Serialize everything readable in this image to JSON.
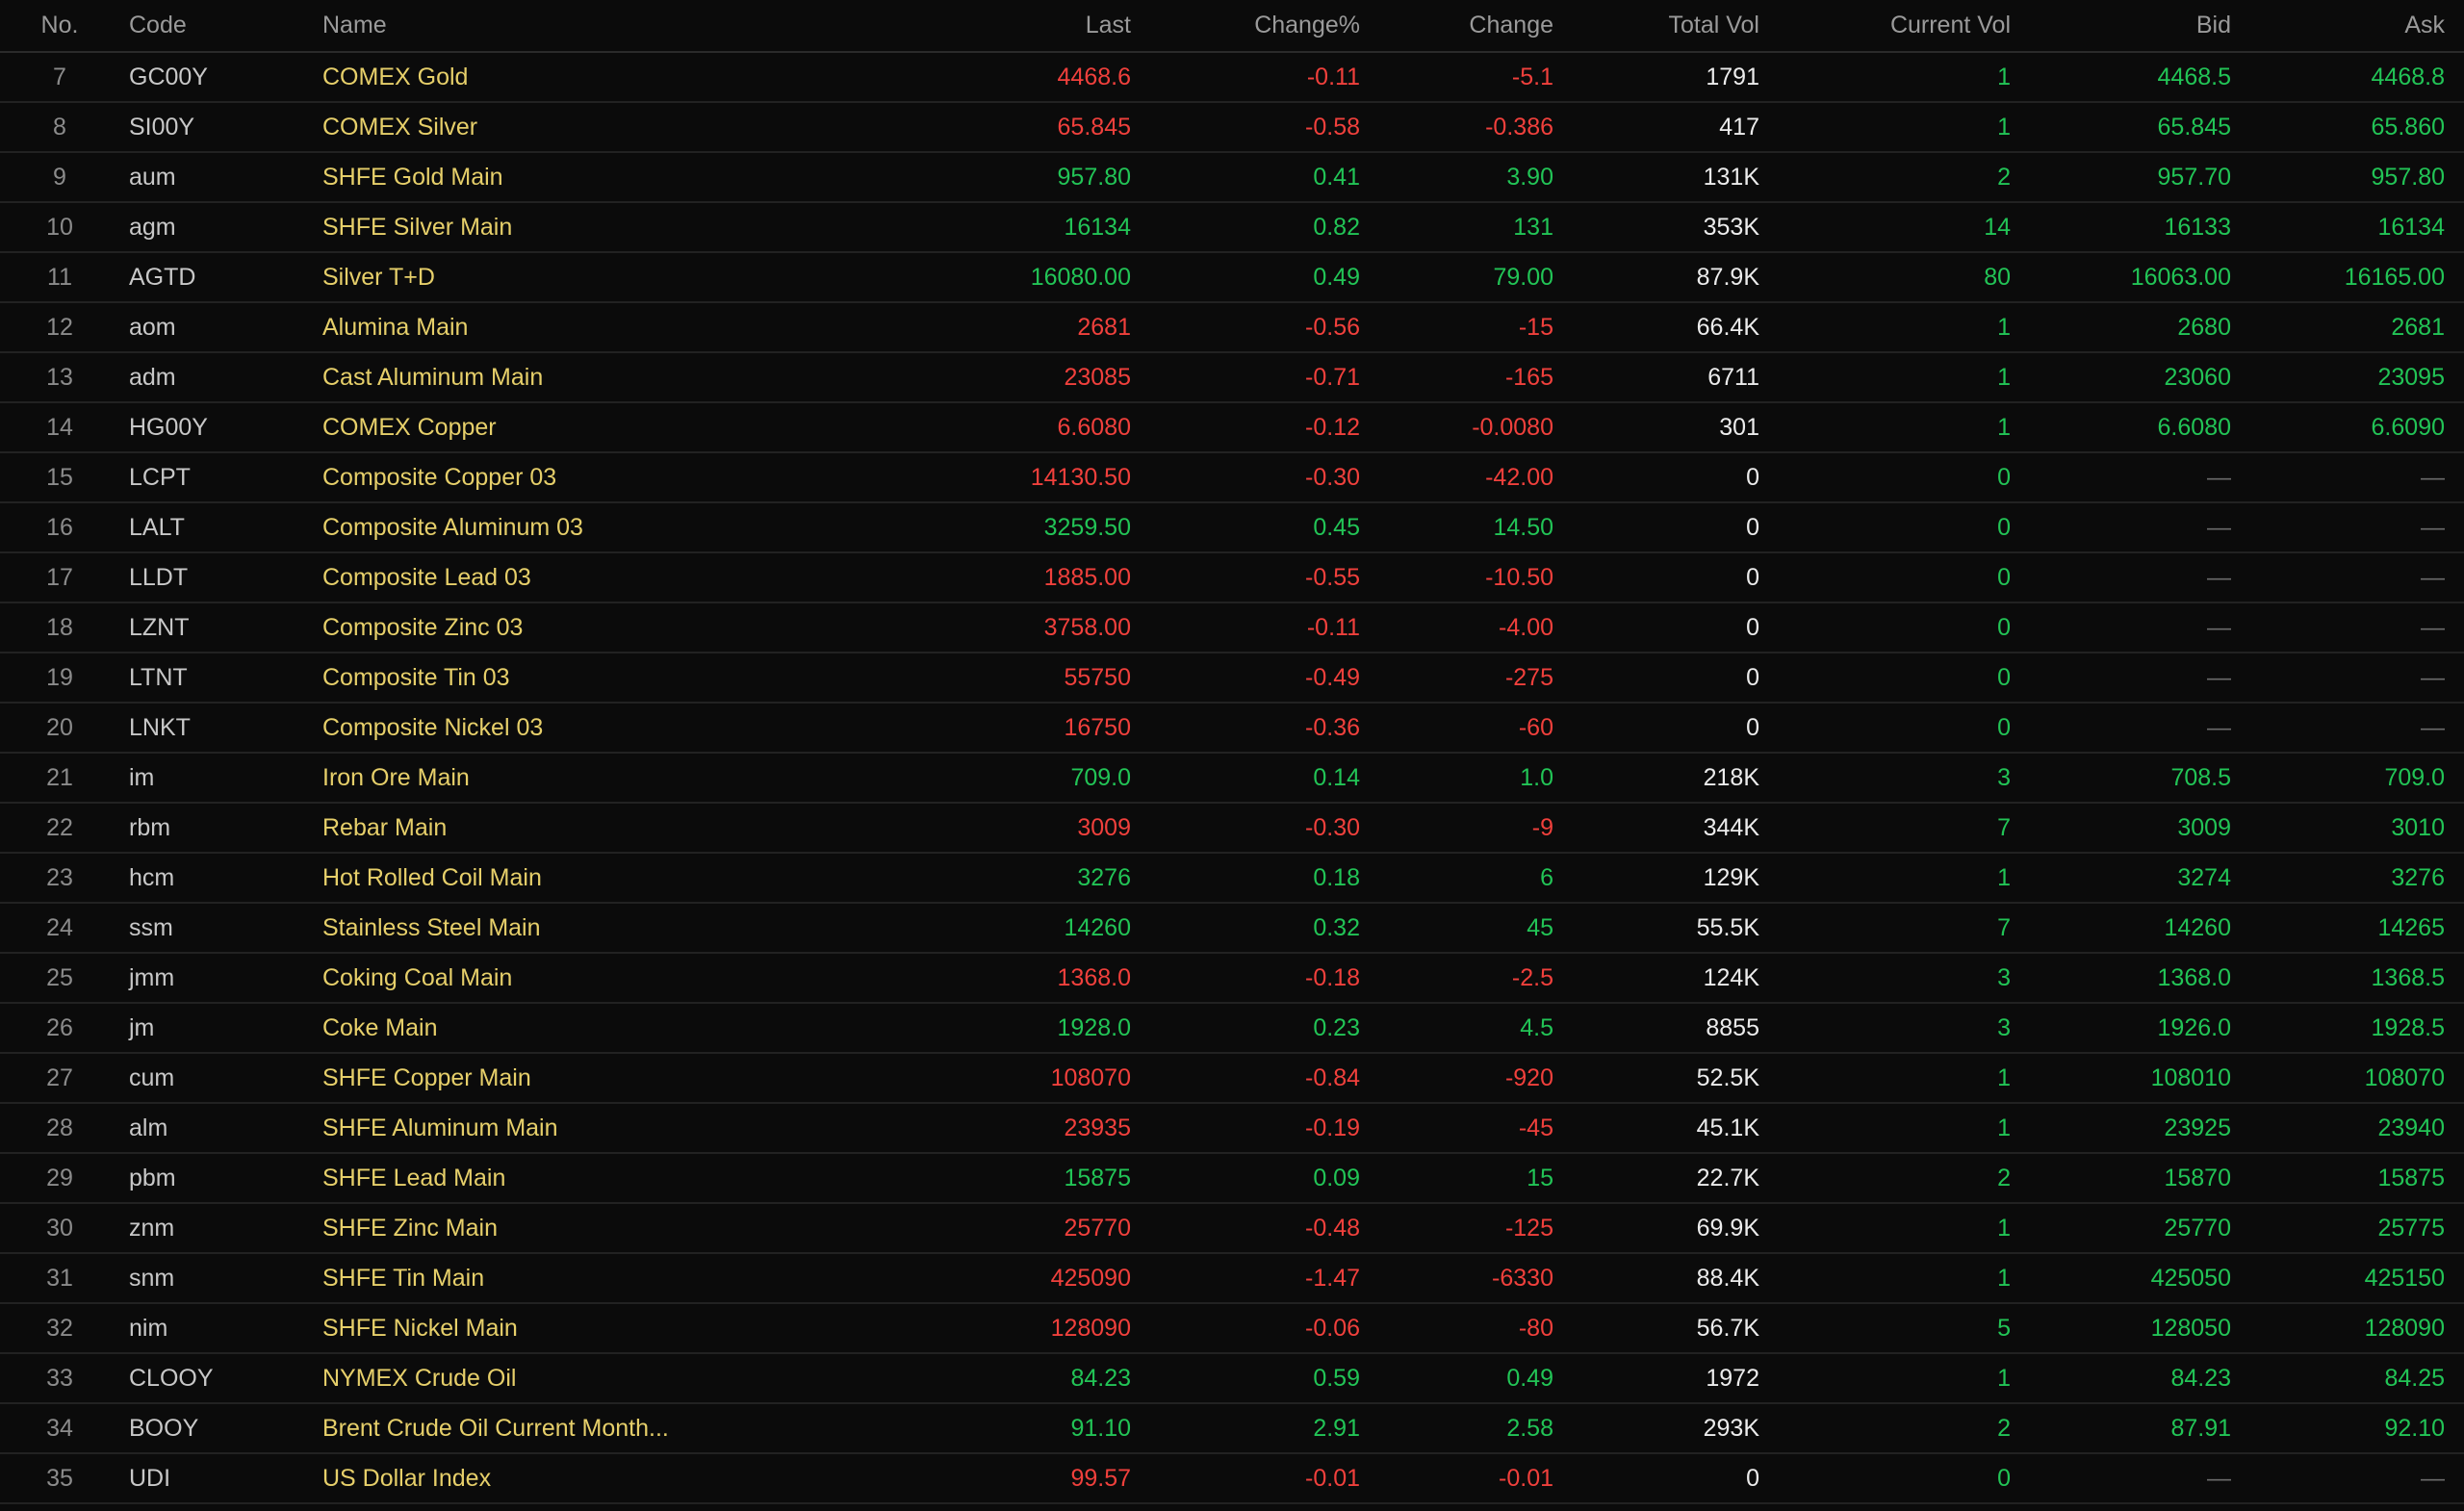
{
  "table": {
    "headers": {
      "no": "No.",
      "code": "Code",
      "name": "Name",
      "last": "Last",
      "change_pct": "Change%",
      "change": "Change",
      "total_vol": "Total Vol",
      "current_vol": "Current Vol",
      "bid": "Bid",
      "ask": "Ask"
    },
    "colors": {
      "up": "#22c456",
      "down": "#f0403c",
      "name": "#e6cf6a",
      "background": "#0b0b0b"
    },
    "rows": [
      {
        "no": "7",
        "code": "GC00Y",
        "name": "COMEX Gold",
        "last": "4468.6",
        "change_pct": "-0.11",
        "change": "-5.1",
        "total_vol": "1791",
        "current_vol": "1",
        "bid": "4468.5",
        "ask": "4468.8",
        "dir": "down"
      },
      {
        "no": "8",
        "code": "SI00Y",
        "name": "COMEX Silver",
        "last": "65.845",
        "change_pct": "-0.58",
        "change": "-0.386",
        "total_vol": "417",
        "current_vol": "1",
        "bid": "65.845",
        "ask": "65.860",
        "dir": "down"
      },
      {
        "no": "9",
        "code": "aum",
        "name": "SHFE Gold Main",
        "last": "957.80",
        "change_pct": "0.41",
        "change": "3.90",
        "total_vol": "131K",
        "current_vol": "2",
        "bid": "957.70",
        "ask": "957.80",
        "dir": "up"
      },
      {
        "no": "10",
        "code": "agm",
        "name": "SHFE Silver Main",
        "last": "16134",
        "change_pct": "0.82",
        "change": "131",
        "total_vol": "353K",
        "current_vol": "14",
        "bid": "16133",
        "ask": "16134",
        "dir": "up"
      },
      {
        "no": "11",
        "code": "AGTD",
        "name": "Silver T+D",
        "last": "16080.00",
        "change_pct": "0.49",
        "change": "79.00",
        "total_vol": "87.9K",
        "current_vol": "80",
        "bid": "16063.00",
        "ask": "16165.00",
        "dir": "up"
      },
      {
        "no": "12",
        "code": "aom",
        "name": "Alumina Main",
        "last": "2681",
        "change_pct": "-0.56",
        "change": "-15",
        "total_vol": "66.4K",
        "current_vol": "1",
        "bid": "2680",
        "ask": "2681",
        "dir": "down"
      },
      {
        "no": "13",
        "code": "adm",
        "name": "Cast Aluminum Main",
        "last": "23085",
        "change_pct": "-0.71",
        "change": "-165",
        "total_vol": "6711",
        "current_vol": "1",
        "bid": "23060",
        "ask": "23095",
        "dir": "down"
      },
      {
        "no": "14",
        "code": "HG00Y",
        "name": "COMEX Copper",
        "last": "6.6080",
        "change_pct": "-0.12",
        "change": "-0.0080",
        "total_vol": "301",
        "current_vol": "1",
        "bid": "6.6080",
        "ask": "6.6090",
        "dir": "down"
      },
      {
        "no": "15",
        "code": "LCPT",
        "name": "Composite Copper 03",
        "last": "14130.50",
        "change_pct": "-0.30",
        "change": "-42.00",
        "total_vol": "0",
        "current_vol": "0",
        "bid": "—",
        "ask": "—",
        "dir": "down"
      },
      {
        "no": "16",
        "code": "LALT",
        "name": "Composite Aluminum 03",
        "last": "3259.50",
        "change_pct": "0.45",
        "change": "14.50",
        "total_vol": "0",
        "current_vol": "0",
        "bid": "—",
        "ask": "—",
        "dir": "up"
      },
      {
        "no": "17",
        "code": "LLDT",
        "name": "Composite Lead 03",
        "last": "1885.00",
        "change_pct": "-0.55",
        "change": "-10.50",
        "total_vol": "0",
        "current_vol": "0",
        "bid": "—",
        "ask": "—",
        "dir": "down"
      },
      {
        "no": "18",
        "code": "LZNT",
        "name": "Composite Zinc 03",
        "last": "3758.00",
        "change_pct": "-0.11",
        "change": "-4.00",
        "total_vol": "0",
        "current_vol": "0",
        "bid": "—",
        "ask": "—",
        "dir": "down"
      },
      {
        "no": "19",
        "code": "LTNT",
        "name": "Composite Tin 03",
        "last": "55750",
        "change_pct": "-0.49",
        "change": "-275",
        "total_vol": "0",
        "current_vol": "0",
        "bid": "—",
        "ask": "—",
        "dir": "down"
      },
      {
        "no": "20",
        "code": "LNKT",
        "name": "Composite Nickel 03",
        "last": "16750",
        "change_pct": "-0.36",
        "change": "-60",
        "total_vol": "0",
        "current_vol": "0",
        "bid": "—",
        "ask": "—",
        "dir": "down"
      },
      {
        "no": "21",
        "code": "im",
        "name": "Iron Ore Main",
        "last": "709.0",
        "change_pct": "0.14",
        "change": "1.0",
        "total_vol": "218K",
        "current_vol": "3",
        "bid": "708.5",
        "ask": "709.0",
        "dir": "up"
      },
      {
        "no": "22",
        "code": "rbm",
        "name": "Rebar Main",
        "last": "3009",
        "change_pct": "-0.30",
        "change": "-9",
        "total_vol": "344K",
        "current_vol": "7",
        "bid": "3009",
        "ask": "3010",
        "dir": "down"
      },
      {
        "no": "23",
        "code": "hcm",
        "name": "Hot Rolled Coil Main",
        "last": "3276",
        "change_pct": "0.18",
        "change": "6",
        "total_vol": "129K",
        "current_vol": "1",
        "bid": "3274",
        "ask": "3276",
        "dir": "up"
      },
      {
        "no": "24",
        "code": "ssm",
        "name": "Stainless Steel Main",
        "last": "14260",
        "change_pct": "0.32",
        "change": "45",
        "total_vol": "55.5K",
        "current_vol": "7",
        "bid": "14260",
        "ask": "14265",
        "dir": "up"
      },
      {
        "no": "25",
        "code": "jmm",
        "name": "Coking Coal Main",
        "last": "1368.0",
        "change_pct": "-0.18",
        "change": "-2.5",
        "total_vol": "124K",
        "current_vol": "3",
        "bid": "1368.0",
        "ask": "1368.5",
        "dir": "down"
      },
      {
        "no": "26",
        "code": "jm",
        "name": "Coke Main",
        "last": "1928.0",
        "change_pct": "0.23",
        "change": "4.5",
        "total_vol": "8855",
        "current_vol": "3",
        "bid": "1926.0",
        "ask": "1928.5",
        "dir": "up"
      },
      {
        "no": "27",
        "code": "cum",
        "name": "SHFE Copper Main",
        "last": "108070",
        "change_pct": "-0.84",
        "change": "-920",
        "total_vol": "52.5K",
        "current_vol": "1",
        "bid": "108010",
        "ask": "108070",
        "dir": "down"
      },
      {
        "no": "28",
        "code": "alm",
        "name": "SHFE Aluminum Main",
        "last": "23935",
        "change_pct": "-0.19",
        "change": "-45",
        "total_vol": "45.1K",
        "current_vol": "1",
        "bid": "23925",
        "ask": "23940",
        "dir": "down"
      },
      {
        "no": "29",
        "code": "pbm",
        "name": "SHFE Lead Main",
        "last": "15875",
        "change_pct": "0.09",
        "change": "15",
        "total_vol": "22.7K",
        "current_vol": "2",
        "bid": "15870",
        "ask": "15875",
        "dir": "up"
      },
      {
        "no": "30",
        "code": "znm",
        "name": "SHFE Zinc Main",
        "last": "25770",
        "change_pct": "-0.48",
        "change": "-125",
        "total_vol": "69.9K",
        "current_vol": "1",
        "bid": "25770",
        "ask": "25775",
        "dir": "down"
      },
      {
        "no": "31",
        "code": "snm",
        "name": "SHFE Tin Main",
        "last": "425090",
        "change_pct": "-1.47",
        "change": "-6330",
        "total_vol": "88.4K",
        "current_vol": "1",
        "bid": "425050",
        "ask": "425150",
        "dir": "down"
      },
      {
        "no": "32",
        "code": "nim",
        "name": "SHFE Nickel Main",
        "last": "128090",
        "change_pct": "-0.06",
        "change": "-80",
        "total_vol": "56.7K",
        "current_vol": "5",
        "bid": "128050",
        "ask": "128090",
        "dir": "down"
      },
      {
        "no": "33",
        "code": "CLOOY",
        "name": "NYMEX Crude Oil",
        "last": "84.23",
        "change_pct": "0.59",
        "change": "0.49",
        "total_vol": "1972",
        "current_vol": "1",
        "bid": "84.23",
        "ask": "84.25",
        "dir": "up"
      },
      {
        "no": "34",
        "code": "BOOY",
        "name": "Brent Crude Oil Current Month...",
        "last": "91.10",
        "change_pct": "2.91",
        "change": "2.58",
        "total_vol": "293K",
        "current_vol": "2",
        "bid": "87.91",
        "ask": "92.10",
        "dir": "up"
      },
      {
        "no": "35",
        "code": "UDI",
        "name": "US Dollar Index",
        "last": "99.57",
        "change_pct": "-0.01",
        "change": "-0.01",
        "total_vol": "0",
        "current_vol": "0",
        "bid": "—",
        "ask": "—",
        "dir": "down"
      }
    ]
  }
}
